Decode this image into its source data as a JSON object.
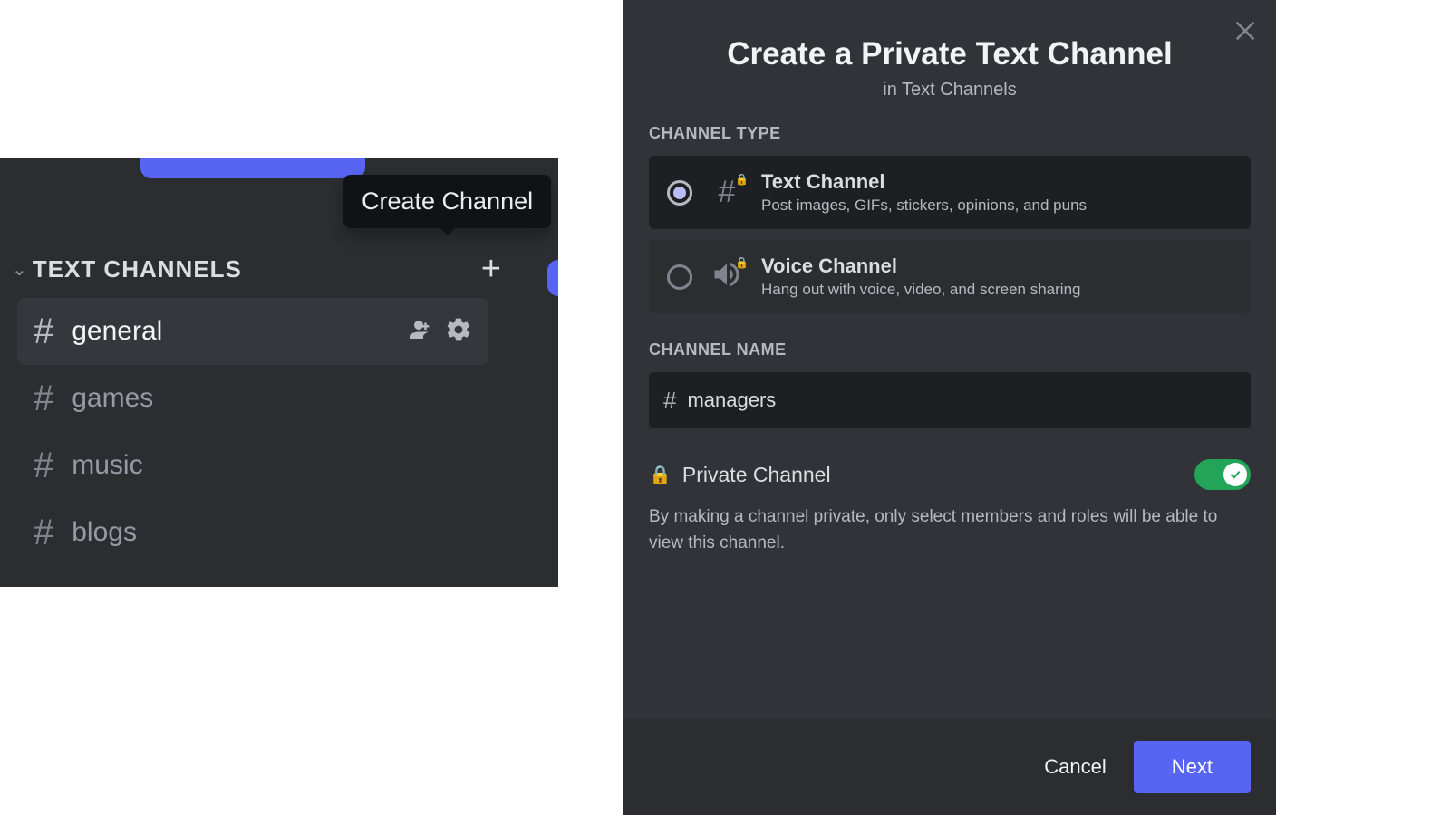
{
  "sidebar": {
    "tooltip": "Create Channel",
    "category": "TEXT CHANNELS",
    "channels": [
      {
        "name": "general",
        "selected": true
      },
      {
        "name": "games",
        "selected": false
      },
      {
        "name": "music",
        "selected": false
      },
      {
        "name": "blogs",
        "selected": false
      }
    ]
  },
  "modal": {
    "title": "Create a Private Text Channel",
    "subtitle": "in Text Channels",
    "channel_type_label": "CHANNEL TYPE",
    "types": {
      "text": {
        "title": "Text Channel",
        "desc": "Post images, GIFs, stickers, opinions, and puns"
      },
      "voice": {
        "title": "Voice Channel",
        "desc": "Hang out with voice, video, and screen sharing"
      }
    },
    "channel_name_label": "CHANNEL NAME",
    "channel_name_value": "managers",
    "private": {
      "title": "Private Channel",
      "desc": "By making a channel private, only select members and roles will be able to view this channel."
    },
    "cancel": "Cancel",
    "next": "Next"
  }
}
